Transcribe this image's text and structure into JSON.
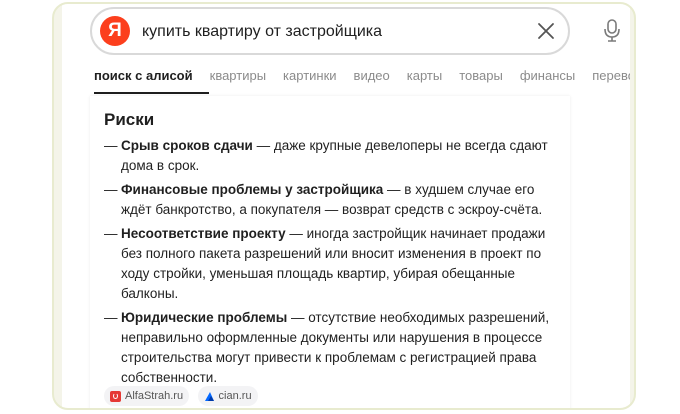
{
  "search": {
    "logo_letter": "Я",
    "query": "купить квартиру от застройщика"
  },
  "tabs": [
    {
      "label": "поиск с алисой",
      "active": true
    },
    {
      "label": "квартиры"
    },
    {
      "label": "картинки"
    },
    {
      "label": "видео"
    },
    {
      "label": "карты"
    },
    {
      "label": "товары"
    },
    {
      "label": "финансы"
    },
    {
      "label": "перевод"
    }
  ],
  "answer": {
    "heading": "Риски",
    "dash": "—",
    "items": [
      {
        "title": "Срыв сроков сдачи",
        "text": " — даже крупные девелоперы не всегда сдают дома в срок."
      },
      {
        "title": "Финансовые проблемы у застройщика",
        "text": " — в худшем случае его ждёт банкротство, а покупателя — возврат средств с эскроу-счёта."
      },
      {
        "title": "Несоответствие проекту",
        "text": " — иногда застройщик начинает продажи без полного пакета разрешений или вносит изменения в проект по ходу стройки, уменьшая площадь квартир, убирая обещанные балконы."
      },
      {
        "title": "Юридические проблемы",
        "text": " — отсутствие необходимых разрешений, неправильно оформленные документы или нарушения в процессе строительства могут привести к проблемам с регистрацией права собственности."
      }
    ],
    "sources": [
      {
        "label": "AlfaStrah.ru",
        "icon": "alfastrah-icon"
      },
      {
        "label": "cian.ru",
        "icon": "cian-icon"
      }
    ]
  },
  "colors": {
    "brand": "#fc3f1d",
    "frame": "#f4f4e9",
    "text": "#1f1f1f",
    "muted": "#8b8b8b"
  }
}
